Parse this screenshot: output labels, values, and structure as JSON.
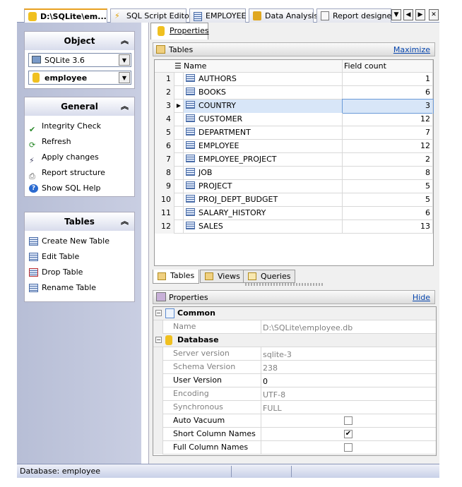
{
  "tabs": [
    {
      "label": "D:\\SQLite\\em...",
      "icon": "database-icon",
      "active": true
    },
    {
      "label": "SQL Script Editor",
      "icon": "sql-script-icon"
    },
    {
      "label": "EMPLOYEE",
      "icon": "table-icon"
    },
    {
      "label": "Data Analysis",
      "icon": "cube-icon"
    },
    {
      "label": "Report designer",
      "icon": "report-icon"
    }
  ],
  "left": {
    "object": {
      "title": "Object",
      "server": "SQLite 3.6",
      "database": "employee"
    },
    "general": {
      "title": "General",
      "items": [
        "Integrity Check",
        "Refresh",
        "Apply changes",
        "Report structure",
        "Show SQL Help"
      ]
    },
    "tables": {
      "title": "Tables",
      "items": [
        "Create New Table",
        "Edit Table",
        "Drop Table",
        "Rename Table"
      ]
    }
  },
  "main": {
    "tab": "Properties",
    "tables_bar": {
      "title": "Tables",
      "action": "Maximize"
    },
    "columns": [
      "Name",
      "Field count"
    ],
    "rows": [
      [
        "1",
        "AUTHORS",
        "1"
      ],
      [
        "2",
        "BOOKS",
        "6"
      ],
      [
        "3",
        "COUNTRY",
        "3"
      ],
      [
        "4",
        "CUSTOMER",
        "12"
      ],
      [
        "5",
        "DEPARTMENT",
        "7"
      ],
      [
        "6",
        "EMPLOYEE",
        "12"
      ],
      [
        "7",
        "EMPLOYEE_PROJECT",
        "2"
      ],
      [
        "8",
        "JOB",
        "8"
      ],
      [
        "9",
        "PROJECT",
        "5"
      ],
      [
        "10",
        "PROJ_DEPT_BUDGET",
        "5"
      ],
      [
        "11",
        "SALARY_HISTORY",
        "6"
      ],
      [
        "12",
        "SALES",
        "13"
      ]
    ],
    "selected_row": 3,
    "bottom_tabs": [
      "Tables",
      "Views",
      "Queries"
    ],
    "props_bar": {
      "title": "Properties",
      "action": "Hide"
    },
    "props": [
      {
        "category": "Common"
      },
      {
        "name": "Name",
        "value": "D:\\SQLite\\employee.db",
        "grey": true
      },
      {
        "category": "Database"
      },
      {
        "name": "Server version",
        "value": "sqlite-3",
        "grey": true
      },
      {
        "name": "Schema Version",
        "value": "238",
        "grey": true
      },
      {
        "name": "User Version",
        "value": "0"
      },
      {
        "name": "Encoding",
        "value": "UTF-8",
        "grey": true
      },
      {
        "name": "Synchronous",
        "value": "FULL",
        "grey": true
      },
      {
        "name": "Auto Vacuum",
        "check": false
      },
      {
        "name": "Short Column Names",
        "check": true
      },
      {
        "name": "Full Column Names",
        "check": false
      }
    ]
  },
  "status": {
    "text": "Database: employee"
  }
}
